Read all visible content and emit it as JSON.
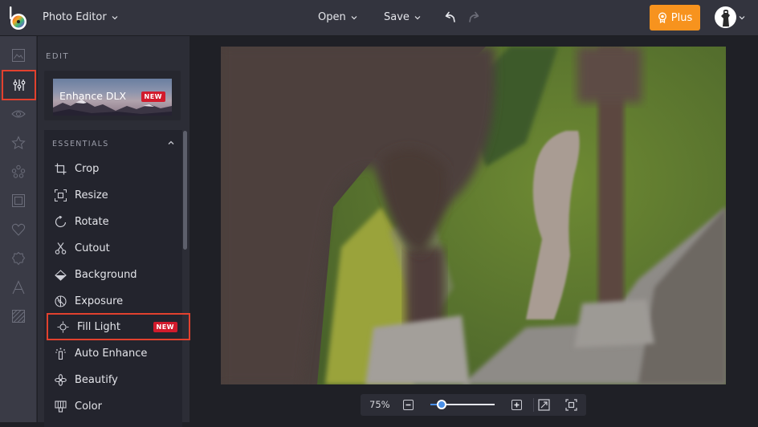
{
  "header": {
    "app_title": "Photo Editor",
    "open_label": "Open",
    "save_label": "Save",
    "plus_label": "Plus",
    "colors": {
      "plus_bg": "#f7931e",
      "bar_bg": "#33343e"
    }
  },
  "rail": {
    "items": [
      {
        "name": "image-icon",
        "active": false
      },
      {
        "name": "adjustments-icon",
        "active": true
      },
      {
        "name": "eye-icon",
        "active": false
      },
      {
        "name": "star-icon",
        "active": false
      },
      {
        "name": "graphics-icon",
        "active": false
      },
      {
        "name": "frame-icon",
        "active": false
      },
      {
        "name": "heart-icon",
        "active": false
      },
      {
        "name": "badge-icon",
        "active": false
      },
      {
        "name": "text-icon",
        "active": false
      },
      {
        "name": "texture-icon",
        "active": false
      }
    ]
  },
  "panel": {
    "section_label": "EDIT",
    "enhance_card": {
      "title": "Enhance DLX",
      "badge": "NEW"
    },
    "essentials": {
      "header": "ESSENTIALS",
      "tools": [
        {
          "label": "Crop",
          "icon": "crop-icon"
        },
        {
          "label": "Resize",
          "icon": "resize-icon"
        },
        {
          "label": "Rotate",
          "icon": "rotate-icon"
        },
        {
          "label": "Cutout",
          "icon": "scissors-icon"
        },
        {
          "label": "Background",
          "icon": "background-icon"
        },
        {
          "label": "Exposure",
          "icon": "exposure-icon"
        },
        {
          "label": "Fill Light",
          "icon": "fill-light-icon",
          "badge": "NEW",
          "highlighted": true
        },
        {
          "label": "Auto Enhance",
          "icon": "auto-enhance-icon"
        },
        {
          "label": "Beautify",
          "icon": "beautify-icon"
        },
        {
          "label": "Color",
          "icon": "color-icon"
        }
      ]
    },
    "colors": {
      "badge_bg": "#d21b2c",
      "highlight_border": "#e2412e"
    }
  },
  "zoom": {
    "percent_label": "75%",
    "slider_fraction": 0.17,
    "accent": "#4a8fe7"
  }
}
